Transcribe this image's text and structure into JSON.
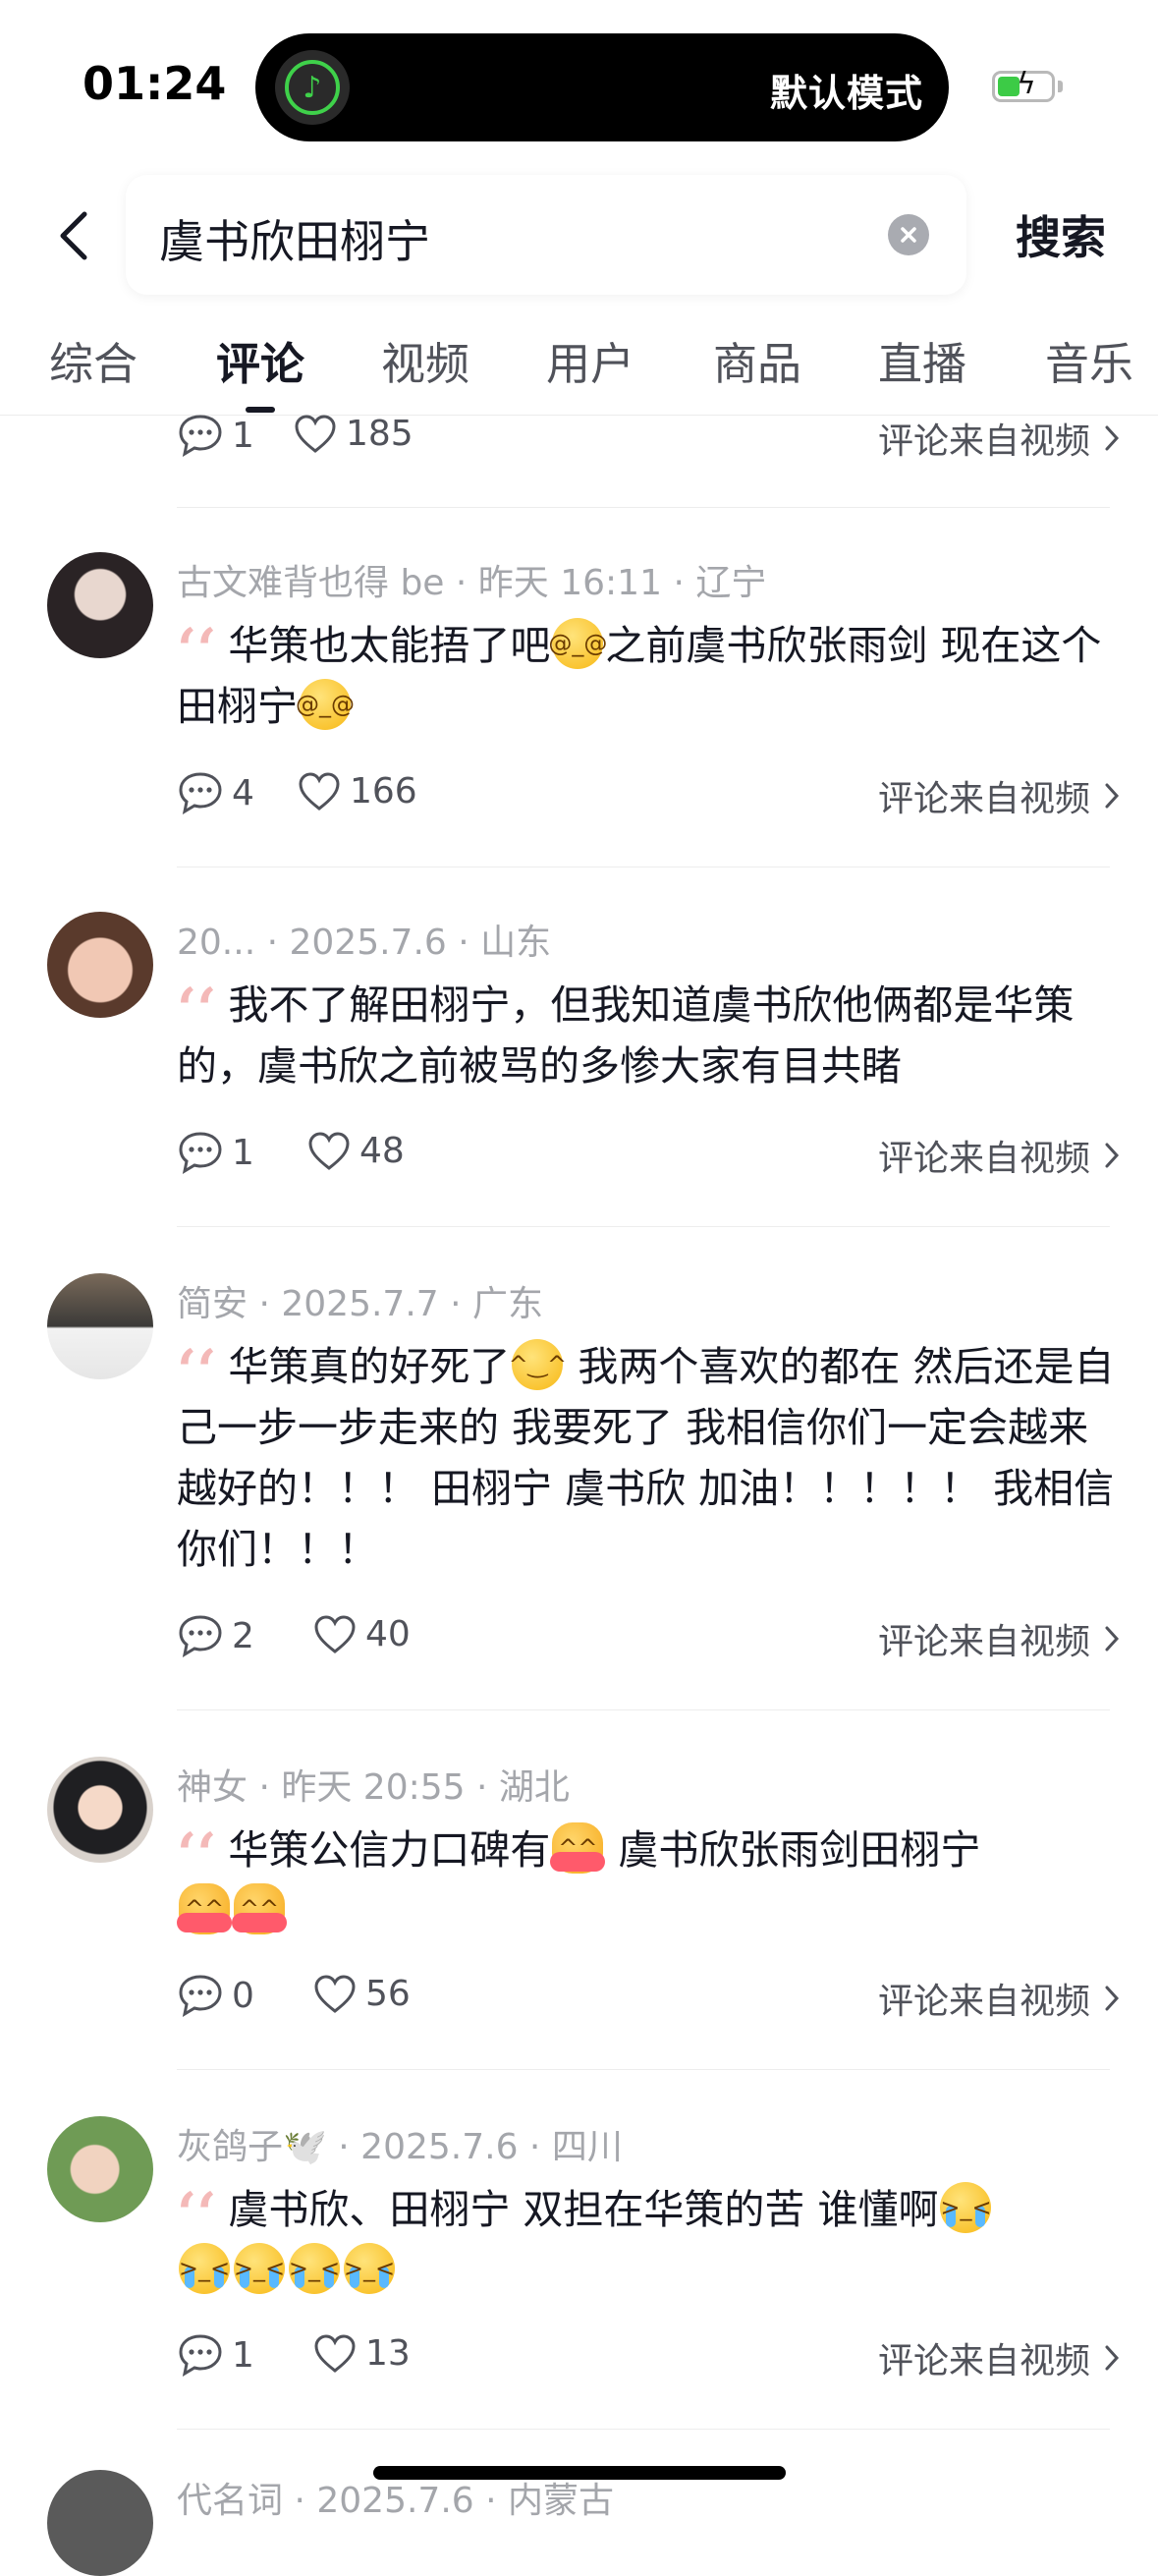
{
  "status": {
    "time": "01:24",
    "mode_label": "默认模式",
    "app_icon": "music-app-icon"
  },
  "search": {
    "query": "虞书欣田栩宁",
    "button_label": "搜索"
  },
  "tabs": [
    {
      "label": "综合",
      "active": false
    },
    {
      "label": "评论",
      "active": true
    },
    {
      "label": "视频",
      "active": false
    },
    {
      "label": "用户",
      "active": false
    },
    {
      "label": "商品",
      "active": false
    },
    {
      "label": "直播",
      "active": false
    },
    {
      "label": "音乐",
      "active": false
    }
  ],
  "source_label": "评论来自视频",
  "top_partial": {
    "replies": "1",
    "likes": "185"
  },
  "comments": [
    {
      "user": "古文难背也得 be",
      "time": "昨天 16:11",
      "location": "辽宁",
      "text_1": "华策也太能捂了吧",
      "text_2": "之前虞书欣张雨剑 现在这个田栩宁",
      "replies": "4",
      "likes": "166"
    },
    {
      "user": "20...",
      "time": "2025.7.6",
      "location": "山东",
      "text_1": "我不了解田栩宁，但我知道虞书欣他俩都是华策的，虞书欣之前被骂的多惨大家有目共睹",
      "replies": "1",
      "likes": "48"
    },
    {
      "user": "简安",
      "time": "2025.7.7",
      "location": "广东",
      "text_1": "华策真的好死了",
      "text_2": " 我两个喜欢的都在 然后还是自己一步一步走来的 我要死了 我相信你们一定会越来越好的！！！ 田栩宁 虞书欣 加油！！！！！ 我相信你们！！！",
      "replies": "2",
      "likes": "40"
    },
    {
      "user": "神女",
      "time": "昨天 20:55",
      "location": "湖北",
      "text_1": "华策公信力口碑有",
      "text_2": " 虞书欣张雨剑田栩宁",
      "replies": "0",
      "likes": "56"
    },
    {
      "user": "灰鸽子🕊️",
      "time": "2025.7.6",
      "location": "四川",
      "text_1": "虞书欣、田栩宁 双担在华策的苦 谁懂啊",
      "replies": "1",
      "likes": "13"
    }
  ],
  "bottom_partial": {
    "user": "代名词",
    "time": "2025.7.6",
    "location": "内蒙古"
  },
  "colors": {
    "text": "#161823",
    "secondary": "#50525a",
    "meta": "#a4a6ab",
    "quote": "#f4b9b8"
  }
}
